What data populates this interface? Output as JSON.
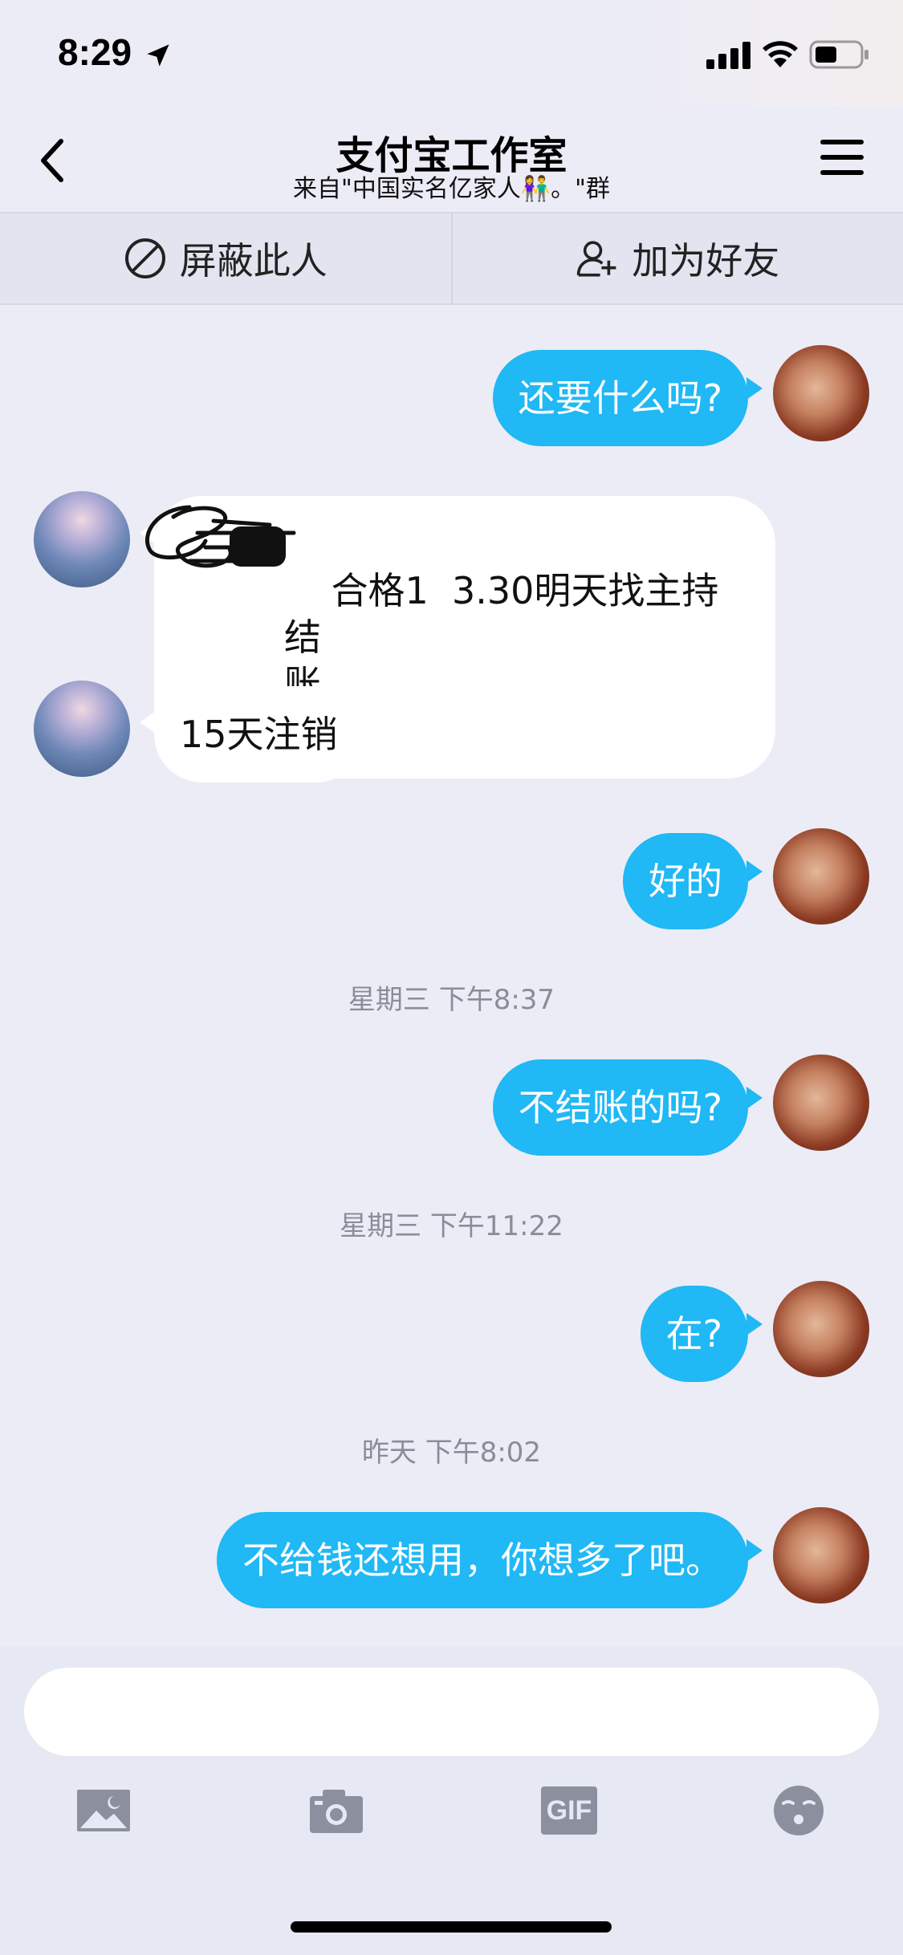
{
  "status_bar": {
    "time": "8:29"
  },
  "header": {
    "title": "支付宝工作室",
    "subtitle": "来自\"中国实名亿家人👫。\"群"
  },
  "actions": {
    "block_label": "屏蔽此人",
    "add_friend_label": "加为好友"
  },
  "messages": [
    {
      "from": "me",
      "text": "还要什么吗?"
    },
    {
      "from": "other",
      "text": "合格1  3.30明天找主持结\n账"
    },
    {
      "from": "other",
      "text": "15天注销"
    },
    {
      "from": "me",
      "text": "好的"
    },
    {
      "type": "timestamp",
      "text": "星期三 下午8:37"
    },
    {
      "from": "me",
      "text": "不结账的吗?"
    },
    {
      "type": "timestamp",
      "text": "星期三 下午11:22"
    },
    {
      "from": "me",
      "text": "在?"
    },
    {
      "type": "timestamp",
      "text": "昨天 下午8:02"
    },
    {
      "from": "me",
      "text": "不给钱还想用，你想多了吧。"
    }
  ],
  "input": {
    "placeholder": ""
  },
  "toolbar": {
    "icons": [
      "image-icon",
      "camera-icon",
      "gif-icon",
      "emoji-icon"
    ],
    "gif_label": "GIF"
  },
  "colors": {
    "accent": "#20b8f5",
    "background": "#ececf6",
    "other_bubble": "#ffffff"
  }
}
